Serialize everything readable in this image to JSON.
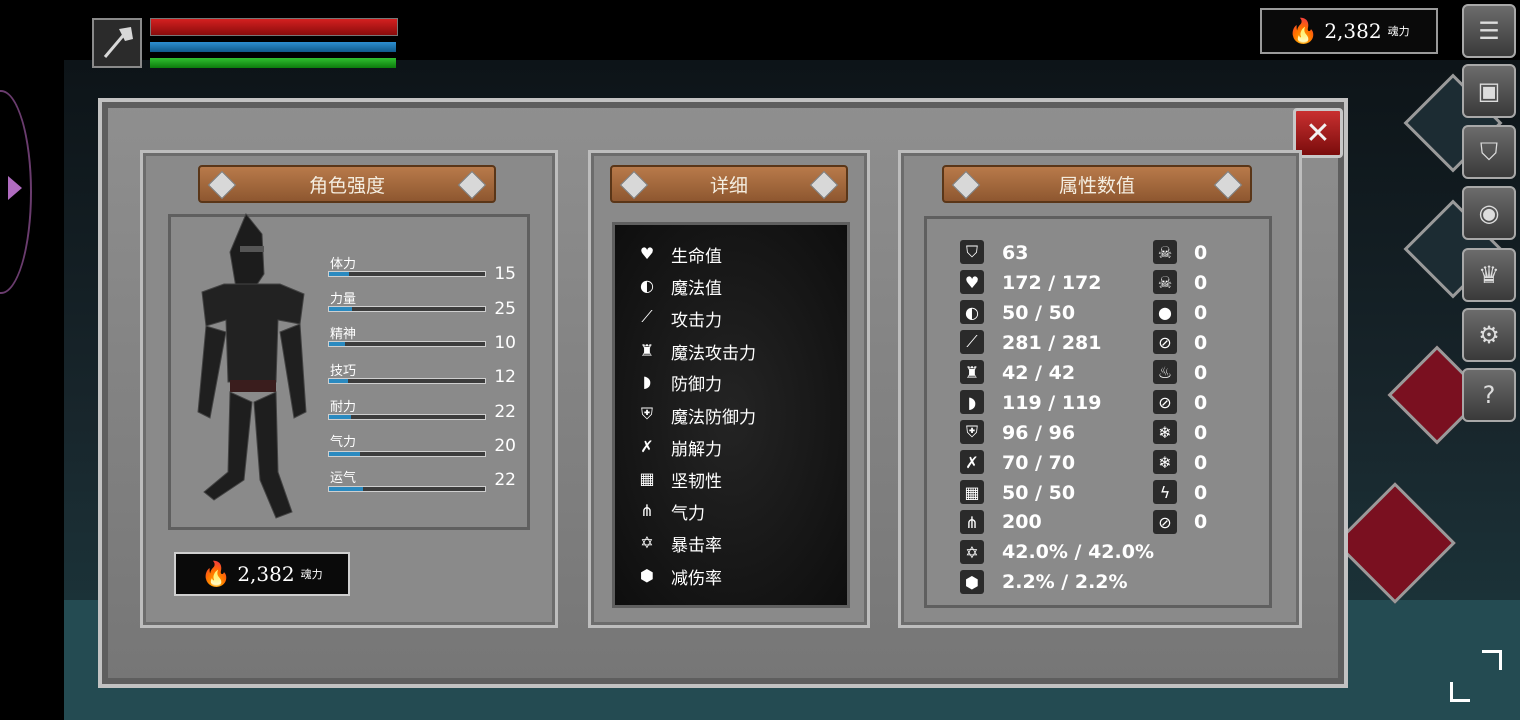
{
  "hud": {
    "currency_value": "2,382",
    "currency_unit": "魂力"
  },
  "side_menu": [
    {
      "icon": "list-icon"
    },
    {
      "icon": "character-icon"
    },
    {
      "icon": "helmet-icon"
    },
    {
      "icon": "emblem-icon"
    },
    {
      "icon": "crown-icon"
    },
    {
      "icon": "gear-icon"
    },
    {
      "icon": "help-icon",
      "glyph": "?"
    }
  ],
  "panel": {
    "strength_title": "角色强度",
    "detail_title": "详细",
    "attributes_title": "属性数值",
    "currency_value": "2,382",
    "currency_unit": "魂力"
  },
  "base_stats": [
    {
      "label": "体力",
      "value": "15",
      "fill": 0.13
    },
    {
      "label": "力量",
      "value": "25",
      "fill": 0.15
    },
    {
      "label": "精神",
      "value": "10",
      "fill": 0.1
    },
    {
      "label": "技巧",
      "value": "12",
      "fill": 0.12
    },
    {
      "label": "耐力",
      "value": "22",
      "fill": 0.14
    },
    {
      "label": "气力",
      "value": "20",
      "fill": 0.2
    },
    {
      "label": "运气",
      "value": "22",
      "fill": 0.22
    }
  ],
  "details": [
    {
      "icon": "heart-icon",
      "label": "生命值"
    },
    {
      "icon": "head-icon",
      "label": "魔法值"
    },
    {
      "icon": "sword-icon",
      "label": "攻击力"
    },
    {
      "icon": "magic-castle-icon",
      "label": "魔法攻击力"
    },
    {
      "icon": "shield-icon",
      "label": "防御力"
    },
    {
      "icon": "magic-shield-icon",
      "label": "魔法防御力"
    },
    {
      "icon": "break-icon",
      "label": "崩解力"
    },
    {
      "icon": "helm-icon",
      "label": "坚韧性"
    },
    {
      "icon": "lungs-icon",
      "label": "气力"
    },
    {
      "icon": "crit-star-icon",
      "label": "暴击率"
    },
    {
      "icon": "damage-reduction-icon",
      "label": "减伤率"
    }
  ],
  "attributes": [
    {
      "icon": "armor-icon",
      "value": "63"
    },
    {
      "icon": "heart-icon",
      "value": "172 / 172"
    },
    {
      "icon": "head-icon",
      "value": "50 / 50"
    },
    {
      "icon": "sword-icon",
      "value": "281 / 281"
    },
    {
      "icon": "magic-castle-icon",
      "value": "42 / 42"
    },
    {
      "icon": "shield-icon",
      "value": "119 / 119"
    },
    {
      "icon": "magic-shield-icon",
      "value": "96 / 96"
    },
    {
      "icon": "break-icon",
      "value": "70 / 70"
    },
    {
      "icon": "helm-icon",
      "value": "50 / 50"
    },
    {
      "icon": "lungs-icon",
      "value": "200"
    },
    {
      "icon": "crit-star-icon",
      "value": "42.0% / 42.0%"
    },
    {
      "icon": "damage-reduction-icon",
      "value": "2.2% / 2.2%"
    }
  ],
  "resistances": [
    {
      "icon": "poison-skull-icon",
      "value": "0"
    },
    {
      "icon": "poison-resist-icon",
      "value": "0"
    },
    {
      "icon": "bleed-drop-icon",
      "value": "0"
    },
    {
      "icon": "bleed-resist-icon",
      "value": "0"
    },
    {
      "icon": "fire-icon",
      "value": "0"
    },
    {
      "icon": "fire-resist-icon",
      "value": "0"
    },
    {
      "icon": "frost-icon",
      "value": "0"
    },
    {
      "icon": "frost-resist-icon",
      "value": "0"
    },
    {
      "icon": "lightning-icon",
      "value": "0"
    },
    {
      "icon": "lightning-resist-icon",
      "value": "0"
    }
  ],
  "colors": {
    "hp": "#c81a1a",
    "mp": "#2080c0",
    "stamina": "#20b020",
    "stat_fill": "#2a8ac0",
    "plank": "#a86a3c",
    "close": "#b02020"
  }
}
